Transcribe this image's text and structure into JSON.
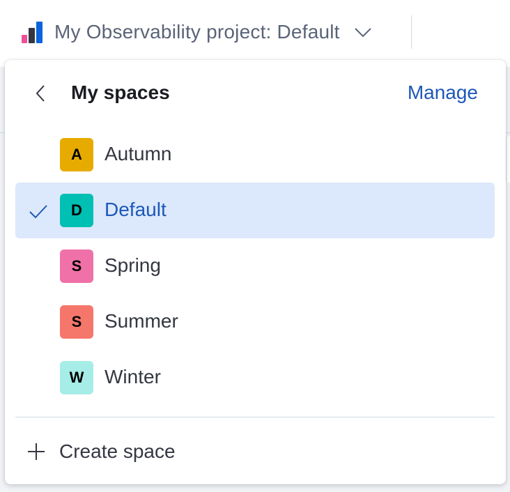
{
  "topbar": {
    "project_title": "My Observability project: Default",
    "logo_icon": "observability-logo-icon",
    "chevron_icon": "chevron-down-icon"
  },
  "popover": {
    "title": "My spaces",
    "back_icon": "arrow-left-icon",
    "manage_label": "Manage",
    "spaces": [
      {
        "initial": "A",
        "label": "Autumn",
        "color": "#e7ab00",
        "selected": false
      },
      {
        "initial": "D",
        "label": "Default",
        "color": "#00bfb3",
        "selected": true
      },
      {
        "initial": "S",
        "label": "Spring",
        "color": "#f071a8",
        "selected": false
      },
      {
        "initial": "S",
        "label": "Summer",
        "color": "#f5776b",
        "selected": false
      },
      {
        "initial": "W",
        "label": "Winter",
        "color": "#a6ede7",
        "selected": false
      }
    ],
    "create_label": "Create space",
    "create_icon": "plus-icon",
    "check_icon": "check-icon"
  },
  "colors": {
    "accent": "#1c58b8",
    "selected_bg": "#dce8fb"
  }
}
